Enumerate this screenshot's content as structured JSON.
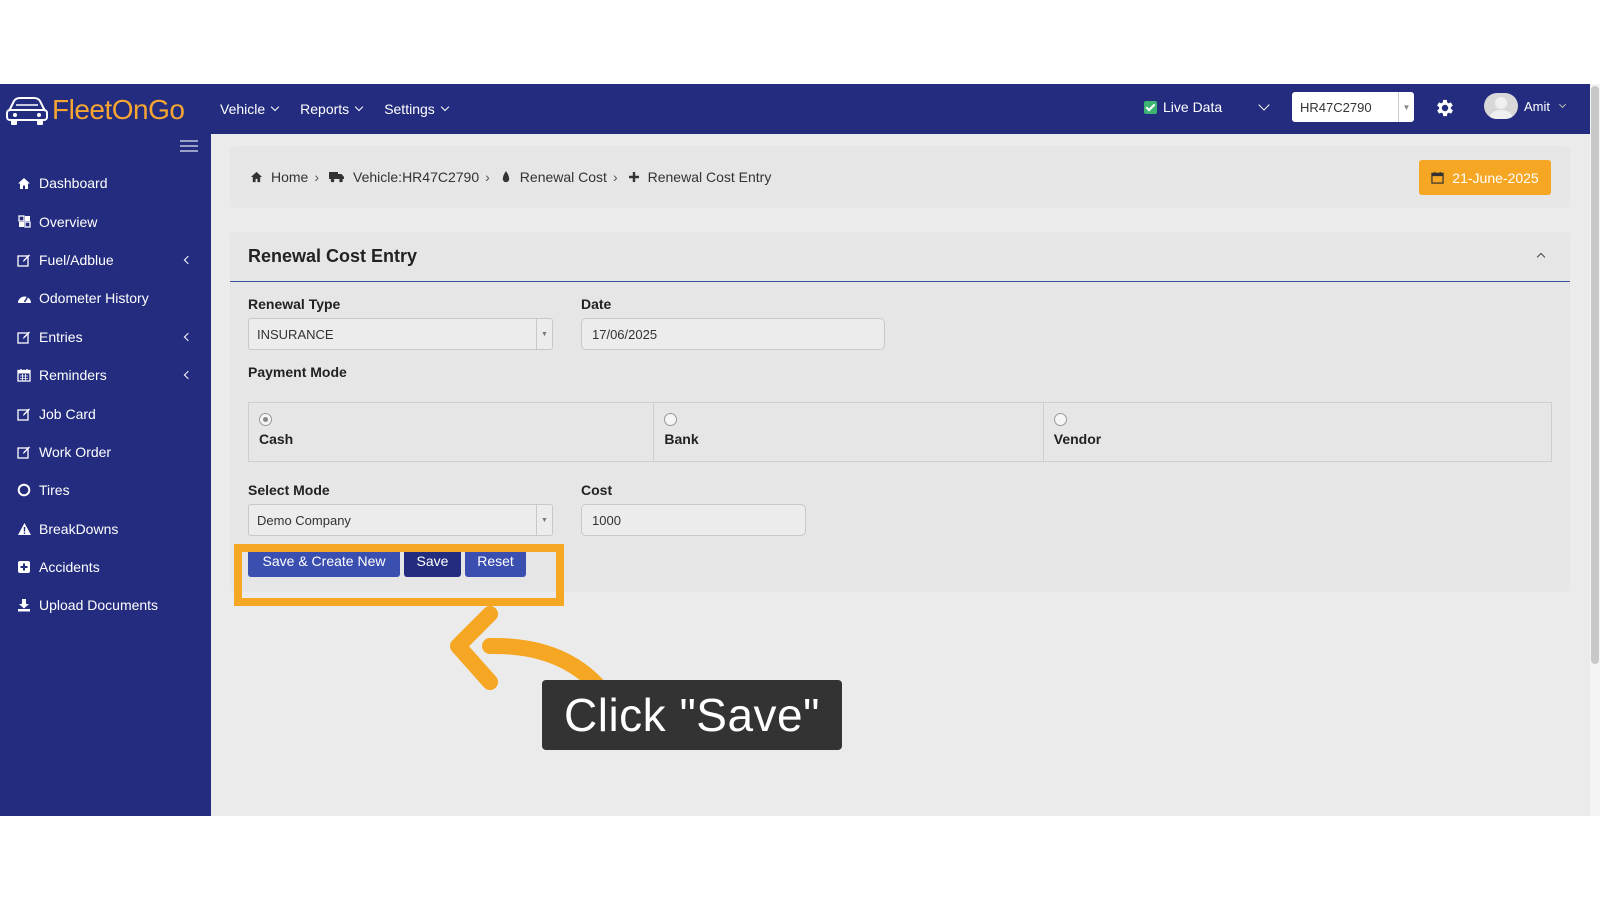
{
  "app": {
    "logo_text": "FleetOnGo",
    "nav": [
      {
        "label": "Vehicle"
      },
      {
        "label": "Reports"
      },
      {
        "label": "Settings"
      }
    ],
    "live_data_label": "Live Data",
    "vehicle_selected": "HR47C2790",
    "user_name": "Amit"
  },
  "sidebar": {
    "items": [
      {
        "label": "Dashboard",
        "icon": "home-icon",
        "expandable": false
      },
      {
        "label": "Overview",
        "icon": "grid-icon",
        "expandable": false
      },
      {
        "label": "Fuel/Adblue",
        "icon": "edit-icon",
        "expandable": true
      },
      {
        "label": "Odometer History",
        "icon": "dashboard-gauge-icon",
        "expandable": false
      },
      {
        "label": "Entries",
        "icon": "edit-icon",
        "expandable": true
      },
      {
        "label": "Reminders",
        "icon": "calendar-icon",
        "expandable": true
      },
      {
        "label": "Job Card",
        "icon": "edit-icon",
        "expandable": false
      },
      {
        "label": "Work Order",
        "icon": "edit-icon",
        "expandable": false
      },
      {
        "label": "Tires",
        "icon": "circle-icon",
        "expandable": false
      },
      {
        "label": "BreakDowns",
        "icon": "warning-icon",
        "expandable": false
      },
      {
        "label": "Accidents",
        "icon": "plus-square-icon",
        "expandable": false
      },
      {
        "label": "Upload Documents",
        "icon": "download-icon",
        "expandable": false
      }
    ]
  },
  "breadcrumb": [
    {
      "label": "Home",
      "icon": "home-icon"
    },
    {
      "label": "Vehicle:HR47C2790",
      "icon": "truck-icon"
    },
    {
      "label": "Renewal Cost",
      "icon": "drop-icon"
    },
    {
      "label": "Renewal Cost Entry",
      "icon": "plus-icon"
    }
  ],
  "date_badge": "21-June-2025",
  "form": {
    "title": "Renewal Cost Entry",
    "renewal_type_label": "Renewal Type",
    "renewal_type_value": "INSURANCE",
    "date_label": "Date",
    "date_value": "17/06/2025",
    "payment_mode_label": "Payment Mode",
    "payment_modes": [
      {
        "label": "Cash",
        "checked": true
      },
      {
        "label": "Bank",
        "checked": false
      },
      {
        "label": "Vendor",
        "checked": false
      }
    ],
    "select_mode_label": "Select Mode",
    "select_mode_value": "Demo Company",
    "cost_label": "Cost",
    "cost_value": "1000",
    "buttons": {
      "save_create_new": "Save & Create New",
      "save": "Save",
      "reset": "Reset"
    }
  },
  "overlay": {
    "tooltip_text": "Click \"Save\"",
    "highlight_color": "#f5a623"
  },
  "colors": {
    "brand_navy": "#232c7e",
    "button_blue": "#3a4fb0",
    "accent_orange": "#f5a623"
  }
}
